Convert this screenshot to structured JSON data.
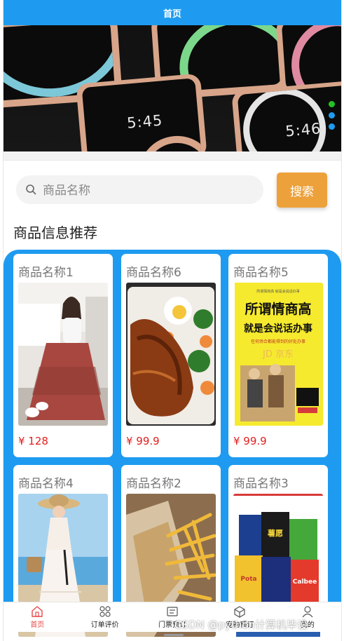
{
  "header": {
    "title": "首页"
  },
  "banner": {
    "clocks": [
      "5:45",
      "5:46"
    ],
    "dot_colors": [
      "#22c322",
      "#1e9bf0",
      "#1e9bf0"
    ]
  },
  "search": {
    "placeholder": "商品名称",
    "value": "",
    "button_label": "搜索"
  },
  "section": {
    "title": "商品信息推荐"
  },
  "products": [
    {
      "name": "商品名称1",
      "price": "¥ 128",
      "image": "woman-floral-skirt"
    },
    {
      "name": "商品名称6",
      "price": "¥ 99.9",
      "image": "teriyaki-chicken-bento"
    },
    {
      "name": "商品名称5",
      "price": "¥ 99.9",
      "image": "book-cover-yellow"
    },
    {
      "name": "商品名称4",
      "price": "",
      "image": "woman-lace-dress-beach"
    },
    {
      "name": "商品名称2",
      "price": "",
      "image": "fries-and-sandwich"
    },
    {
      "name": "商品名称3",
      "price": "",
      "image": "chips-snacks"
    }
  ],
  "book": {
    "title_line1": "所谓情商高",
    "title_line2": "就是会说话办事",
    "subtitle": "任何场合都能得到的好处办事"
  },
  "nav": {
    "items": [
      {
        "label": "首页",
        "icon": "home-icon",
        "active": true
      },
      {
        "label": "订单评价",
        "icon": "grid-icon",
        "active": false
      },
      {
        "label": "门票预订",
        "icon": "ticket-icon",
        "active": false
      },
      {
        "label": "宠物预订",
        "icon": "box-icon",
        "active": false
      },
      {
        "label": "我的",
        "icon": "user-icon",
        "active": false
      }
    ]
  },
  "watermark": "CSDN @python计算机毕设",
  "colors": {
    "primary": "#1e9bf0",
    "accent": "#eda13a",
    "price": "#e02020",
    "active_nav": "#e8494b"
  }
}
